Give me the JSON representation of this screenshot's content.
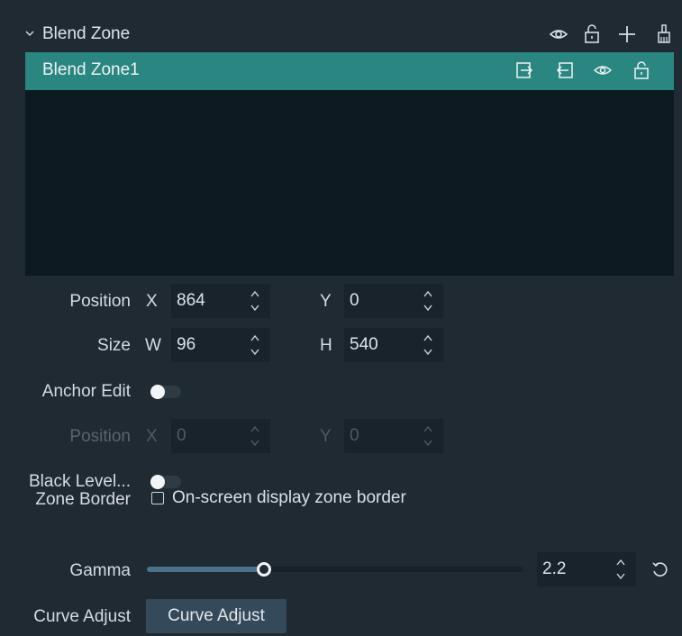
{
  "section": {
    "title": "Blend Zone",
    "header_icons": [
      "eye-icon",
      "unlock-icon",
      "plus-icon",
      "brush-icon"
    ]
  },
  "zones": [
    {
      "name": "Blend Zone1",
      "row_icons": [
        "export-icon",
        "import-icon",
        "eye-icon",
        "unlock-icon"
      ]
    }
  ],
  "position": {
    "label": "Position",
    "x_axis": "X",
    "x_value": "864",
    "y_axis": "Y",
    "y_value": "0"
  },
  "size": {
    "label": "Size",
    "w_axis": "W",
    "w_value": "96",
    "h_axis": "H",
    "h_value": "540"
  },
  "anchor_edit": {
    "label": "Anchor Edit",
    "enabled": false
  },
  "anchor_position": {
    "label": "Position",
    "x_axis": "X",
    "x_value": "0",
    "y_axis": "Y",
    "y_value": "0"
  },
  "black_level": {
    "label": "Black Level...",
    "enabled": false
  },
  "zone_border": {
    "label": "Zone Border",
    "checkbox_label": "On-screen display zone border",
    "checked": false
  },
  "gamma": {
    "label": "Gamma",
    "value": "2.2",
    "slider_fraction": 0.31
  },
  "curve_adjust": {
    "label": "Curve Adjust",
    "button_label": "Curve Adjust"
  },
  "colors": {
    "background": "#1f2a33",
    "list_background": "#0e1a22",
    "selected_row": "#2a8680",
    "button": "#34495a"
  }
}
